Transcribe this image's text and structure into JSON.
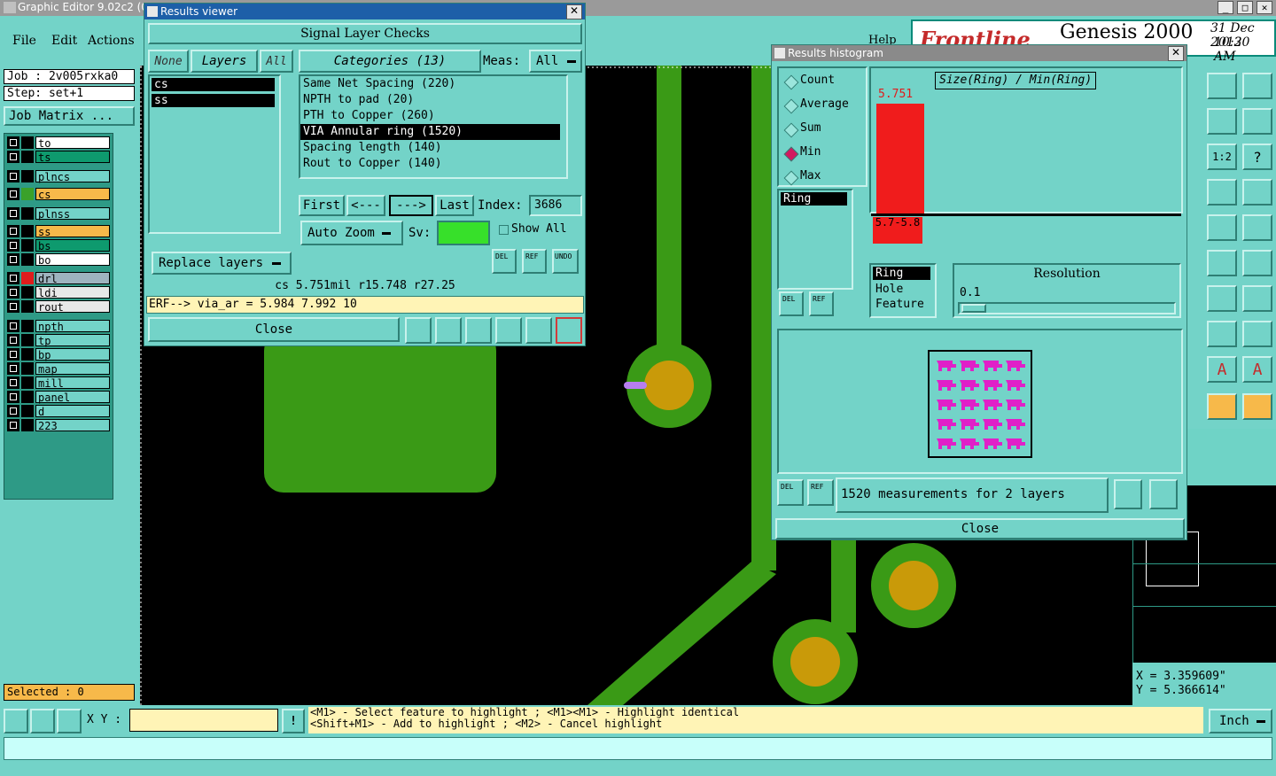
{
  "main": {
    "title": "Graphic Editor 9.02c2 (00",
    "menu": [
      "File",
      "Edit",
      "Actions"
    ],
    "help": "Help",
    "brand": "Frontline",
    "product": "Genesis 2000",
    "date": "31 Dec 2012",
    "time": "10:30 AM",
    "job": "Job : 2v005rxka0",
    "step": "Step: set+1",
    "job_matrix": "Job Matrix ...",
    "selected": "Selected : 0",
    "xy_label": "X Y :",
    "xy_value": "",
    "hint1": "<M1> - Select feature to highlight ; <M1><M1> - Highlight identical",
    "hint2": "<Shift+M1> - Add to highlight ; <M2> - Cancel highlight",
    "units": "Inch",
    "coord_x": "X = 3.359609\"",
    "coord_y": "Y = 5.366614\""
  },
  "layers": [
    {
      "name": "to",
      "color": "#ffffff",
      "sw": "#000000"
    },
    {
      "name": "ts",
      "color": "#0e9a6e",
      "sw": "#000000"
    },
    {
      "name": "plncs",
      "color": "#73d3c8",
      "sw": "#000000"
    },
    {
      "name": "cs",
      "color": "#f7b94a",
      "sw": "#3aa12a"
    },
    {
      "name": "plnss",
      "color": "#73d3c8",
      "sw": "#000000"
    },
    {
      "name": "ss",
      "color": "#f7b94a",
      "sw": "#000000"
    },
    {
      "name": "bs",
      "color": "#0e9a6e",
      "sw": "#000000"
    },
    {
      "name": "bo",
      "color": "#ffffff",
      "sw": "#000000"
    },
    {
      "name": "drl",
      "color": "#9fb3bf",
      "sw": "#e01c1c"
    },
    {
      "name": "ldi",
      "color": "#e8e8e8",
      "sw": "#000000"
    },
    {
      "name": "rout",
      "color": "#e8e8e8",
      "sw": "#000000"
    },
    {
      "name": "npth",
      "color": "#73d3c8",
      "sw": "#000000"
    },
    {
      "name": "tp",
      "color": "#73d3c8",
      "sw": "#000000"
    },
    {
      "name": "bp",
      "color": "#73d3c8",
      "sw": "#000000"
    },
    {
      "name": "map",
      "color": "#73d3c8",
      "sw": "#000000"
    },
    {
      "name": "mill",
      "color": "#73d3c8",
      "sw": "#000000"
    },
    {
      "name": "panel",
      "color": "#73d3c8",
      "sw": "#000000"
    },
    {
      "name": "d",
      "color": "#73d3c8",
      "sw": "#000000"
    },
    {
      "name": "223",
      "color": "#73d3c8",
      "sw": "#000000"
    }
  ],
  "viewer": {
    "title": "Results viewer",
    "header": "Signal Layer Checks",
    "none": "None",
    "layers": "Layers",
    "all": "All",
    "categories": "Categories (13)",
    "meas": "Meas:",
    "meas_value": "All",
    "layer_list": [
      "cs",
      "ss"
    ],
    "category_list": [
      "Same Net Spacing (220)",
      "NPTH to pad (20)",
      "PTH to Copper (260)",
      "VIA Annular ring (1520)",
      "Spacing length (140)",
      "Rout to Copper (140)"
    ],
    "first": "First",
    "prev": "<---",
    "next": "--->",
    "last": "Last",
    "index_label": "Index:",
    "index_value": "3686",
    "auto_zoom": "Auto Zoom",
    "sv": "Sv:",
    "show_all": "Show All",
    "replace_layers": "Replace layers",
    "del": "DEL",
    "ref": "REF",
    "undo": "UNDO",
    "status": "cs  5.751mil  r15.748  r27.25",
    "erf": "ERF--> via_ar = 5.984 7.992 10",
    "close": "Close"
  },
  "histogram": {
    "title": "Results histogram",
    "options": [
      "Count",
      "Average",
      "Sum",
      "Min",
      "Max"
    ],
    "selected_option": "Min",
    "ring_list": [
      "Ring"
    ],
    "chart_title": "Size(Ring) / Min(Ring)",
    "bar_value": "5.751",
    "bar_label": "5.7-5.8",
    "attr_list": [
      "Ring",
      "Hole",
      "Feature"
    ],
    "resolution": "Resolution",
    "resolution_value": "0.1",
    "measurements": "1520 measurements for 2 layers",
    "del": "DEL",
    "ref": "REF",
    "close": "Close"
  }
}
